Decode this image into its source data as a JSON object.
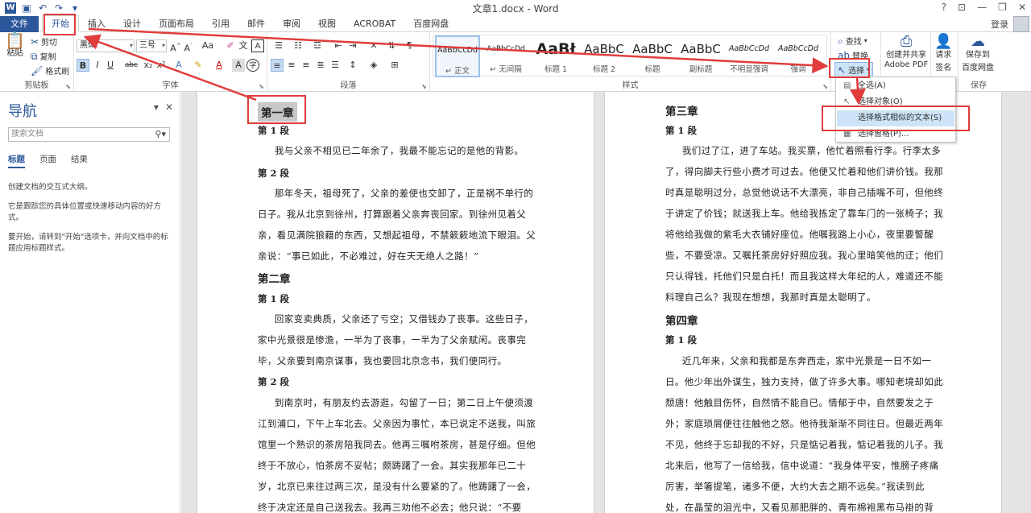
{
  "titlebar": {
    "title": "文章1.docx - Word",
    "controls": [
      "?",
      "⊡",
      "—",
      "❐",
      "✕"
    ]
  },
  "tabs": [
    "文件",
    "开始",
    "插入",
    "设计",
    "页面布局",
    "引用",
    "邮件",
    "审阅",
    "视图",
    "ACROBAT",
    "百度网盘"
  ],
  "account": {
    "login": "登录"
  },
  "ribbon": {
    "clipboard": {
      "label": "剪贴板",
      "paste": "粘贴",
      "cut": "剪切",
      "copy": "复制",
      "painter": "格式刷"
    },
    "font": {
      "label": "字体",
      "name": "黑体",
      "size": "三号",
      "aa": "Aa",
      "bold": "B",
      "italic": "I",
      "underline": "U",
      "strike": "abc",
      "sub": "x₂",
      "sup": "x²"
    },
    "paragraph": {
      "label": "段落"
    },
    "styles": {
      "label": "样式",
      "items": [
        {
          "sample": "AaBbCcDd",
          "name": "↵ 正文"
        },
        {
          "sample": "AaBbCcDd",
          "name": "↵ 无间隔"
        },
        {
          "sample": "AaBł",
          "name": "标题 1"
        },
        {
          "sample": "AaBbC",
          "name": "标题 2"
        },
        {
          "sample": "AaBbC",
          "name": "标题"
        },
        {
          "sample": "AaBbC",
          "name": "副标题"
        },
        {
          "sample": "AaBbCcDd",
          "name": "不明显强调"
        },
        {
          "sample": "AaBbCcDd",
          "name": "强调"
        }
      ]
    },
    "editing": {
      "find": "查找",
      "replace": "替换",
      "select": "选择"
    },
    "adobe": {
      "line1": "创建并共享",
      "line2": "Adobe PDF"
    },
    "sign": {
      "line1": "请求",
      "line2": "签名"
    },
    "save": {
      "line1": "保存到",
      "line2": "百度网盘",
      "label": "保存"
    }
  },
  "select_menu": {
    "items": [
      "全选(A)",
      "选择对象(O)",
      "选择格式相似的文本(S)",
      "选择窗格(P)..."
    ]
  },
  "nav": {
    "title": "导航",
    "search_placeholder": "搜索文档",
    "tabs": [
      "标题",
      "页面",
      "结果"
    ],
    "text1": "创建文档的交互式大纲。",
    "text2": "它是跟踪您的具体位置或快速移动内容的好方式。",
    "text3": "要开始，请转到\"开始\"选项卡，并向文档中的标题应用标题样式。"
  },
  "page1": {
    "lines": [
      "第一章",
      "第 1 段",
      "　我与父亲不相见已二年余了，我最不能忘记的是他的背影。",
      "第 2 段",
      "　那年冬天，祖母死了，父亲的差使也交卸了，正是祸不单行的",
      "日子。我从北京到徐州，打算跟着父亲奔丧回家。到徐州见着父",
      "亲，看见满院狼藉的东西，又想起祖母，不禁簌簌地流下眼泪。父",
      "亲说：“事已如此，不必难过，好在天无绝人之路！”",
      "第二章",
      "第 1 段",
      "　回家变卖典质，父亲还了亏空；又借钱办了丧事。这些日子，",
      "家中光景很是惨澹，一半为了丧事，一半为了父亲赋闲。丧事完",
      "毕，父亲要到南京谋事，我也要回北京念书，我们便同行。",
      "第 2 段",
      "　到南京时，有朋友约去游逛，勾留了一日；第二日上午便须渡",
      "江到浦口，下午上车北去。父亲因为事忙，本已说定不送我，叫旅",
      "馆里一个熟识的茶房陪我同去。他再三嘱咐茶房，甚是仔细。但他",
      "终于不放心，怕茶房不妥帖；颇踌躇了一会。其实我那年已二十",
      "岁，北京已来往过两三次，是没有什么要紧的了。他踌躇了一会，",
      "终于决定还是自己送我去。我再三劝他不必去；他只说：“不要"
    ]
  },
  "page2": {
    "lines": [
      "第三章",
      "第 1 段",
      "　我们过了江，进了车站。我买票，他忙着照看行李。行李太多",
      "了，得向脚夫行些小费才可过去。他便又忙着和他们讲价钱。我那",
      "时真是聪明过分，总觉他说话不大漂亮，非自己插嘴不可，但他终",
      "于讲定了价钱；就送我上车。他给我拣定了靠车门的一张椅子；我",
      "将他给我做的紫毛大衣铺好座位。他嘱我路上小心，夜里要警醒",
      "些，不要受凉。又嘱托茶房好好照应我。我心里暗笑他的迂；他们",
      "只认得钱，托他们只是白托！而且我这样大年纪的人，难道还不能",
      "料理自己么？我现在想想，我那时真是太聪明了。",
      "第四章",
      "第 1 段",
      "　近几年来，父亲和我都是东奔西走，家中光景是一日不如一",
      "日。他少年出外谋生，独力支持，做了许多大事。哪知老境却如此",
      "颓唐！他触目伤怀，自然情不能自已。情郁于中，自然要发之于",
      "外；家庭琐屑便往往触他之怒。他待我渐渐不同往日。但最近两年",
      "不见，他终于忘却我的不好，只是惦记着我，惦记着我的儿子。我",
      "北来后，他写了一信给我，信中说道：“我身体平安，惟膀子疼痛",
      "厉害，举箸提笔，诸多不便，大约大去之期不远矣。”我读到此",
      "处，在晶莹的泪光中，又看见那肥胖的、青布棉袍黑布马褂的背"
    ]
  }
}
